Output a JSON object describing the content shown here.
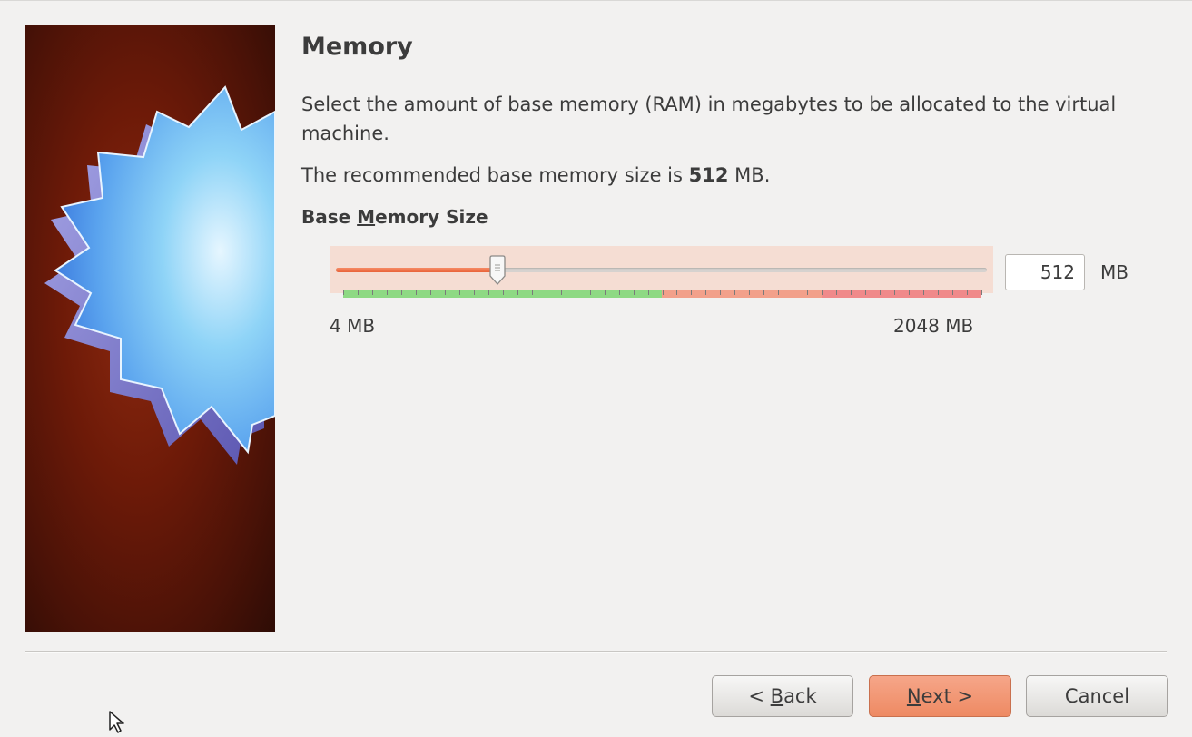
{
  "page": {
    "title": "Memory",
    "description": "Select the amount of base memory (RAM) in megabytes to be allocated to the virtual machine.",
    "recommended_prefix": "The recommended base memory size is",
    "recommended_value": "512",
    "recommended_suffix": "MB."
  },
  "memory": {
    "label_prefix": "Base ",
    "label_mnemonic": "M",
    "label_rest": "emory Size",
    "value": "512",
    "unit": "MB",
    "min_label": "4 MB",
    "max_label": "2048 MB",
    "min": 4,
    "max": 2048,
    "current": 512,
    "zones": [
      {
        "name": "safe",
        "color": "#8ed983",
        "from": 4,
        "to": 1024
      },
      {
        "name": "warning",
        "color": "#f2a08a",
        "from": 1024,
        "to": 1536
      },
      {
        "name": "danger",
        "color": "#f08a8a",
        "from": 1536,
        "to": 2048
      }
    ],
    "accent": "#e9633a"
  },
  "buttons": {
    "back": {
      "pre": "< ",
      "mnemonic": "B",
      "rest": "ack"
    },
    "next": {
      "pre": "",
      "mnemonic": "N",
      "rest": "ext >"
    },
    "cancel": {
      "label": "Cancel"
    }
  },
  "icons": {
    "banner": "starburst-icon",
    "cursor": "mouse-pointer-icon"
  }
}
